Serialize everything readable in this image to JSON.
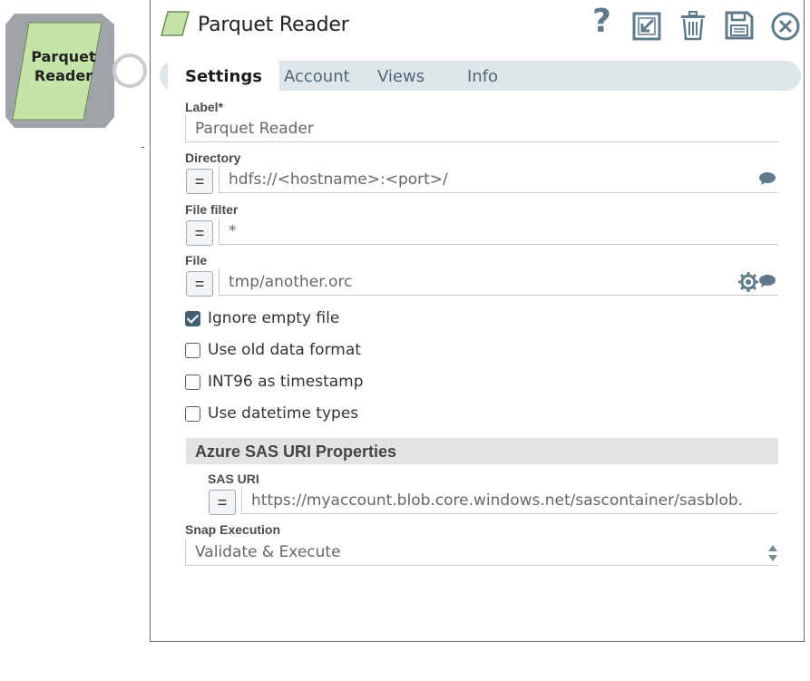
{
  "canvas": {
    "snap": {
      "name_line1": "Parquet",
      "name_line2": "Reader",
      "fill_color": "#c5e4a8"
    }
  },
  "dialog": {
    "title": "Parquet Reader",
    "header_icons": [
      "help-icon",
      "export-icon",
      "trash-icon",
      "save-icon",
      "close-icon"
    ],
    "help_label": "?",
    "tabs": [
      {
        "label": "Settings",
        "active": true
      },
      {
        "label": "Account",
        "active": false
      },
      {
        "label": "Views",
        "active": false
      },
      {
        "label": "Info",
        "active": false
      }
    ],
    "fields": {
      "label": {
        "label": "Label*",
        "value": "Parquet Reader"
      },
      "directory": {
        "label": "Directory",
        "value": "hdfs://<hostname>:<port>/"
      },
      "file_filter": {
        "label": "File filter",
        "value": "*"
      },
      "file": {
        "label": "File",
        "value": "tmp/another.orc"
      }
    },
    "expr_button_label": "=",
    "checkboxes": [
      {
        "label": "Ignore empty file",
        "checked": true
      },
      {
        "label": "Use old data format",
        "checked": false
      },
      {
        "label": "INT96 as timestamp",
        "checked": false
      },
      {
        "label": "Use datetime types",
        "checked": false
      }
    ],
    "section": {
      "title": "Azure SAS URI Properties",
      "sas_uri": {
        "label": "SAS URI",
        "value": "https://myaccount.blob.core.windows.net/sascontainer/sasblob."
      }
    },
    "snap_execution": {
      "label": "Snap Execution",
      "value": "Validate & Execute"
    },
    "colors": {
      "accent": "#435f73",
      "tab_bg": "#dfe6ea",
      "icon": "#5f7a8a"
    }
  }
}
